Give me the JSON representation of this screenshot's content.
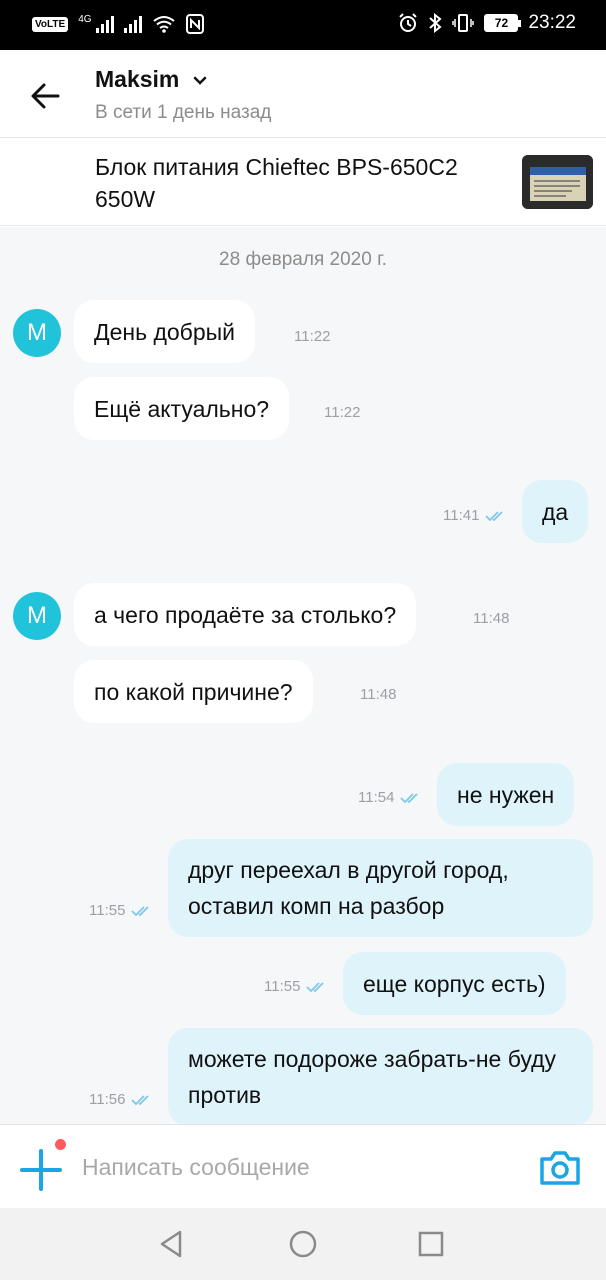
{
  "status_bar": {
    "volte": "VoLTE",
    "network": "4G",
    "battery": "72",
    "time": "23:22"
  },
  "header": {
    "name": "Maksim",
    "status": "В сети 1 день назад"
  },
  "listing": {
    "title": "Блок питания Chieftec BPS-650C2 650W"
  },
  "chat": {
    "date": "28 февраля 2020 г.",
    "avatar_letter": "M",
    "messages": [
      {
        "dir": "in",
        "text": "День добрый",
        "time": "11:22"
      },
      {
        "dir": "in",
        "text": "Ещё актуально?",
        "time": "11:22"
      },
      {
        "dir": "out",
        "text": "да",
        "time": "11:41"
      },
      {
        "dir": "in",
        "text": "а чего продаёте за столько?",
        "time": "11:48"
      },
      {
        "dir": "in",
        "text": "по какой причине?",
        "time": "11:48"
      },
      {
        "dir": "out",
        "text": "не нужен",
        "time": "11:54"
      },
      {
        "dir": "out",
        "text": "друг переехал в другой город, оставил комп на разбор",
        "time": "11:55"
      },
      {
        "dir": "out",
        "text": "еще корпус есть)",
        "time": "11:55"
      },
      {
        "dir": "out",
        "text": "можете подороже забрать-не буду против",
        "time": "11:56"
      }
    ]
  },
  "composer": {
    "placeholder": "Написать сообщение"
  },
  "colors": {
    "accent": "#1aa5e6",
    "avatar": "#21c3db",
    "outgoing_bubble": "#dff3fb",
    "notification_dot": "#ff5a5f"
  },
  "icons": [
    "back-arrow-icon",
    "chevron-down-icon",
    "plus-icon",
    "camera-icon",
    "double-check-icon",
    "nav-back-icon",
    "nav-home-icon",
    "nav-recents-icon"
  ]
}
